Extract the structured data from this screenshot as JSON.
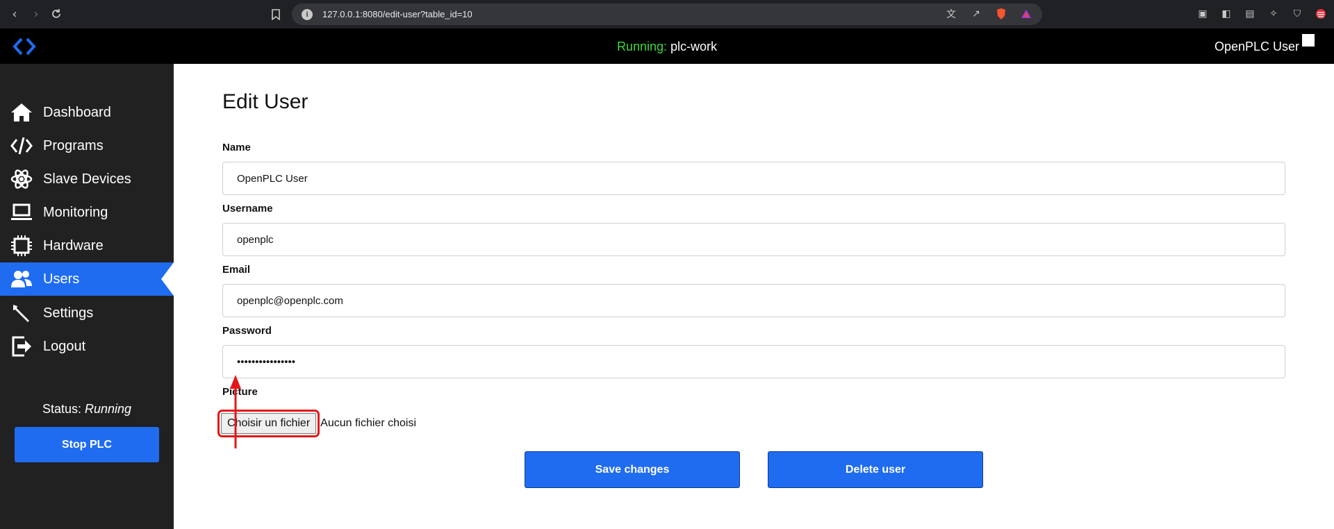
{
  "browser": {
    "url": "127.0.0.1:8080/edit-user?table_id=10"
  },
  "header": {
    "run_label": "Running:",
    "program_name": "plc-work",
    "user_name": "OpenPLC User"
  },
  "sidebar": {
    "items": [
      {
        "label": "Dashboard",
        "icon": "home-icon"
      },
      {
        "label": "Programs",
        "icon": "code-icon"
      },
      {
        "label": "Slave Devices",
        "icon": "atom-icon"
      },
      {
        "label": "Monitoring",
        "icon": "laptop-icon"
      },
      {
        "label": "Hardware",
        "icon": "chip-icon"
      },
      {
        "label": "Users",
        "icon": "users-icon",
        "active": true
      },
      {
        "label": "Settings",
        "icon": "wrench-icon"
      },
      {
        "label": "Logout",
        "icon": "logout-icon"
      }
    ],
    "status_label": "Status:",
    "status_value": "Running",
    "stop_button": "Stop PLC"
  },
  "form": {
    "title": "Edit User",
    "name_label": "Name",
    "name_value": "OpenPLC User",
    "username_label": "Username",
    "username_value": "openplc",
    "email_label": "Email",
    "email_value": "openplc@openplc.com",
    "password_label": "Password",
    "password_value": "••••••••••••••••",
    "picture_label": "Picture",
    "file_button": "Choisir un fichier",
    "file_status": "Aucun fichier choisi",
    "save_button": "Save changes",
    "delete_button": "Delete user"
  },
  "colors": {
    "accent": "#1f6cf0",
    "running_green": "#3ed63e",
    "sidebar_bg": "#212121",
    "highlight_red": "#e4161a"
  }
}
